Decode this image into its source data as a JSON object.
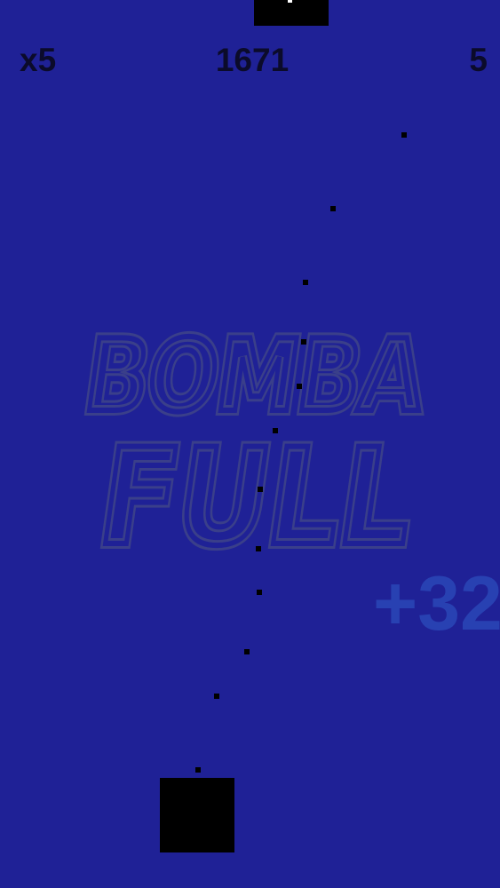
{
  "hud": {
    "multiplier": "x5",
    "score": "1671",
    "level": "5"
  },
  "title": {
    "line1": "BOMBA",
    "line2": "FULL"
  },
  "bonus_text": "+32",
  "colors": {
    "background": "#1f2196",
    "hud_text": "#0b0b2a",
    "title_outline": "#3a3f8a",
    "bonus": "#2a47b8",
    "blocks": "#000000"
  }
}
